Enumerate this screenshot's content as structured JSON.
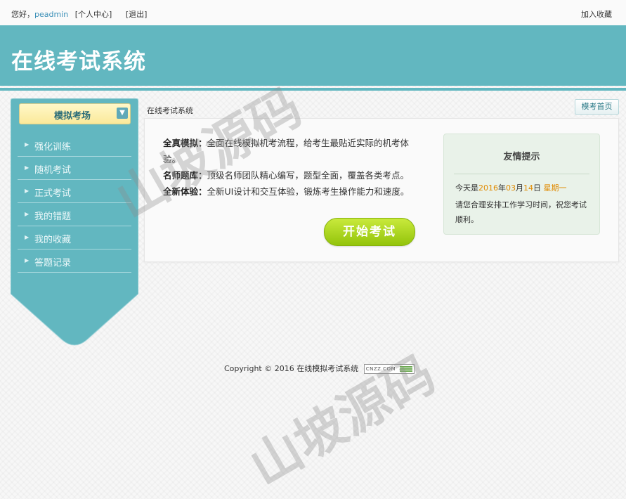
{
  "topbar": {
    "greeting": "您好，",
    "username": "peadmin",
    "profile_link": "[个人中心]",
    "logout_link": "[退出]",
    "favorite": "加入收藏"
  },
  "header": {
    "title": "在线考试系统"
  },
  "sidebar": {
    "heading": "模拟考场",
    "toggle_icon": "chevron-down-icon",
    "items": [
      {
        "label": "强化训练"
      },
      {
        "label": "随机考试"
      },
      {
        "label": "正式考试"
      },
      {
        "label": "我的错题"
      },
      {
        "label": "我的收藏"
      },
      {
        "label": "答题记录"
      }
    ]
  },
  "breadcrumb": "在线考试系统",
  "home_button": "模考首页",
  "main": {
    "features": [
      {
        "title": "全真模拟：",
        "text": "全面在线模拟机考流程，给考生最贴近实际的机考体验。"
      },
      {
        "title": "名师题库：",
        "text": "顶级名师团队精心编写，题型全面，覆盖各类考点。"
      },
      {
        "title": "全新体验：",
        "text": "全新UI设计和交互体验，锻炼考生操作能力和速度。"
      }
    ],
    "start_button": "开始考试"
  },
  "tip": {
    "title": "友情提示",
    "today_prefix": "今天是",
    "year": "2016",
    "year_unit": "年",
    "month": "03",
    "month_unit": "月",
    "day": "14",
    "day_unit": "日",
    "weekday": "星期一",
    "message": "请您合理安排工作学习时间，祝您考试顺利。"
  },
  "footer": {
    "copyright": "Copyright © 2016 在线模拟考试系统",
    "badge": "CNZZ.COM"
  },
  "watermark": "山坡源码",
  "colors": {
    "header": "#62b7c0",
    "start_button": "#a6d21a",
    "accent_orange": "#e08a00"
  }
}
